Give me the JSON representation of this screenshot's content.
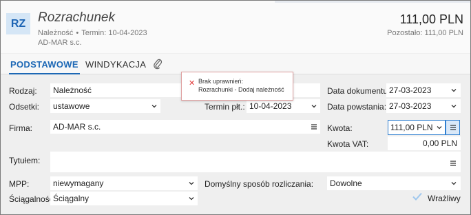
{
  "header": {
    "badge": "RZ",
    "title": "Rozrachunek",
    "type": "Należność",
    "separator": "•",
    "due": "Termin: 10-04-2023",
    "firm": "AD-MAR s.c.",
    "amount": "111,00 PLN",
    "remaining": "Pozostało: 111,00 PLN"
  },
  "tabs": {
    "basic": "PODSTAWOWE",
    "collection": "WINDYKACJA",
    "attachment_icon": "paperclip-icon"
  },
  "tooltip": {
    "line1": "Brak uprawnień:",
    "line2": "Rozrachunki - Dodaj należność",
    "icon": "error-x-icon",
    "color": "#e23a3a"
  },
  "form": {
    "rodzaj_label": "Rodzaj:",
    "rodzaj_value": "Należność",
    "odsetki_label": "Odsetki:",
    "odsetki_value": "ustawowe",
    "termin_label": "Termin płt.:",
    "termin_value": "10-04-2023",
    "data_dok_label": "Data dokumentu:",
    "data_dok_value": "27-03-2023",
    "data_pow_label": "Data powstania:",
    "data_pow_value": "27-03-2023",
    "firma_label": "Firma:",
    "firma_value": "AD-MAR s.c.",
    "kwota_label": "Kwota:",
    "kwota_value": "111,00 PLN",
    "kwota_vat_label": "Kwota VAT:",
    "kwota_vat_value": "0,00 PLN",
    "tytulem_label": "Tytułem:",
    "tytulem_value": "",
    "mpp_label": "MPP:",
    "mpp_value": "niewymagany",
    "sposob_label": "Domyślny sposób rozliczania:",
    "sposob_value": "Dowolne",
    "sciagalnosc_label": "Ściągalność:",
    "sciagalnosc_value": "Ściągalny",
    "wrazliwy_label": "Wrażliwy"
  },
  "colors": {
    "accent": "#1d68b5",
    "badge_bg": "#d5e6f6"
  }
}
